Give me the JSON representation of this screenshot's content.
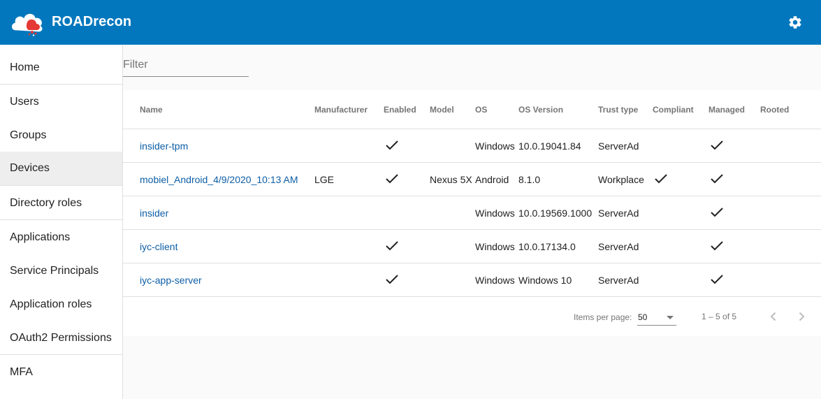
{
  "app": {
    "title": "ROADrecon",
    "accent": "#0277bd",
    "logo_icon": "cloud-logo-icon",
    "settings_icon": "gear-icon"
  },
  "sidebar": {
    "items": [
      {
        "label": "Home"
      },
      {
        "label": "Users"
      },
      {
        "label": "Groups"
      },
      {
        "label": "Devices",
        "active": true
      },
      {
        "label": "Directory roles"
      },
      {
        "label": "Applications"
      },
      {
        "label": "Service Principals"
      },
      {
        "label": "Application roles"
      },
      {
        "label": "OAuth2 Permissions"
      },
      {
        "label": "MFA"
      }
    ]
  },
  "filter": {
    "placeholder": "Filter",
    "value": ""
  },
  "table": {
    "columns": [
      "Name",
      "Manufacturer",
      "Enabled",
      "Model",
      "OS",
      "OS Version",
      "Trust type",
      "Compliant",
      "Managed",
      "Rooted"
    ],
    "rows": [
      {
        "name": "insider-tpm",
        "manufacturer": "",
        "enabled": true,
        "model": "",
        "os": "Windows",
        "os_version": "10.0.19041.84",
        "trust_type": "ServerAd",
        "compliant": false,
        "managed": true,
        "rooted": false
      },
      {
        "name": "mobiel_Android_4/9/2020_10:13 AM",
        "manufacturer": "LGE",
        "enabled": true,
        "model": "Nexus 5X",
        "os": "Android",
        "os_version": "8.1.0",
        "trust_type": "Workplace",
        "compliant": true,
        "managed": true,
        "rooted": false
      },
      {
        "name": "insider",
        "manufacturer": "",
        "enabled": false,
        "model": "",
        "os": "Windows",
        "os_version": "10.0.19569.1000",
        "trust_type": "ServerAd",
        "compliant": false,
        "managed": true,
        "rooted": false
      },
      {
        "name": "iyc-client",
        "manufacturer": "",
        "enabled": true,
        "model": "",
        "os": "Windows",
        "os_version": "10.0.17134.0",
        "trust_type": "ServerAd",
        "compliant": false,
        "managed": true,
        "rooted": false
      },
      {
        "name": "iyc-app-server",
        "manufacturer": "",
        "enabled": true,
        "model": "",
        "os": "Windows",
        "os_version": "Windows 10",
        "trust_type": "ServerAd",
        "compliant": false,
        "managed": true,
        "rooted": false
      }
    ]
  },
  "paginator": {
    "items_per_page_label": "Items per page:",
    "page_size": "50",
    "range_label": "1 – 5 of 5",
    "prev_icon": "chevron-left-icon",
    "next_icon": "chevron-right-icon"
  }
}
